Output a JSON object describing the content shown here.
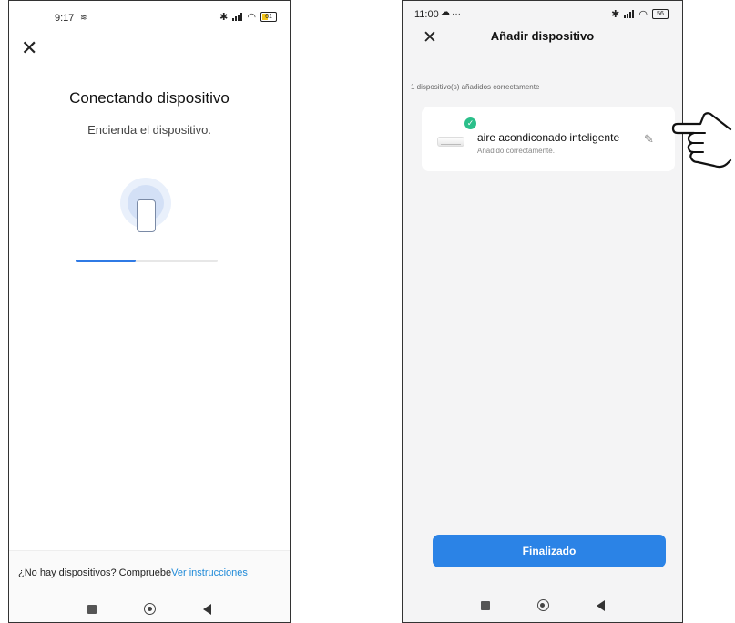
{
  "left_screen": {
    "status_time": "9:17",
    "title": "Conectando dispositivo",
    "subtitle": "Encienda el dispositivo.",
    "progress_fraction": 0.42,
    "no_devices_text": "¿No hay dispositivos? Compruebe",
    "instructions_link": "Ver instrucciones",
    "battery": "61"
  },
  "right_screen": {
    "status_time": "11:00",
    "status_extra": "···",
    "title": "Añadir dispositivo",
    "added_count_text": "1 dispositivo(s) añadidos correctamente",
    "device": {
      "name": "aire acondiconado inteligente",
      "status": "Añadido correctamente."
    },
    "finish_button": "Finalizado",
    "battery": "56"
  },
  "colors": {
    "accent_blue": "#2b83e6",
    "link_blue": "#1f8ad8",
    "success_green": "#2bbf8a"
  },
  "icons": [
    "close-icon",
    "phone-icon",
    "checkmark-icon",
    "edit-pencil-icon",
    "pointing-hand-icon",
    "bluetooth-icon",
    "wifi-icon",
    "battery-icon"
  ]
}
